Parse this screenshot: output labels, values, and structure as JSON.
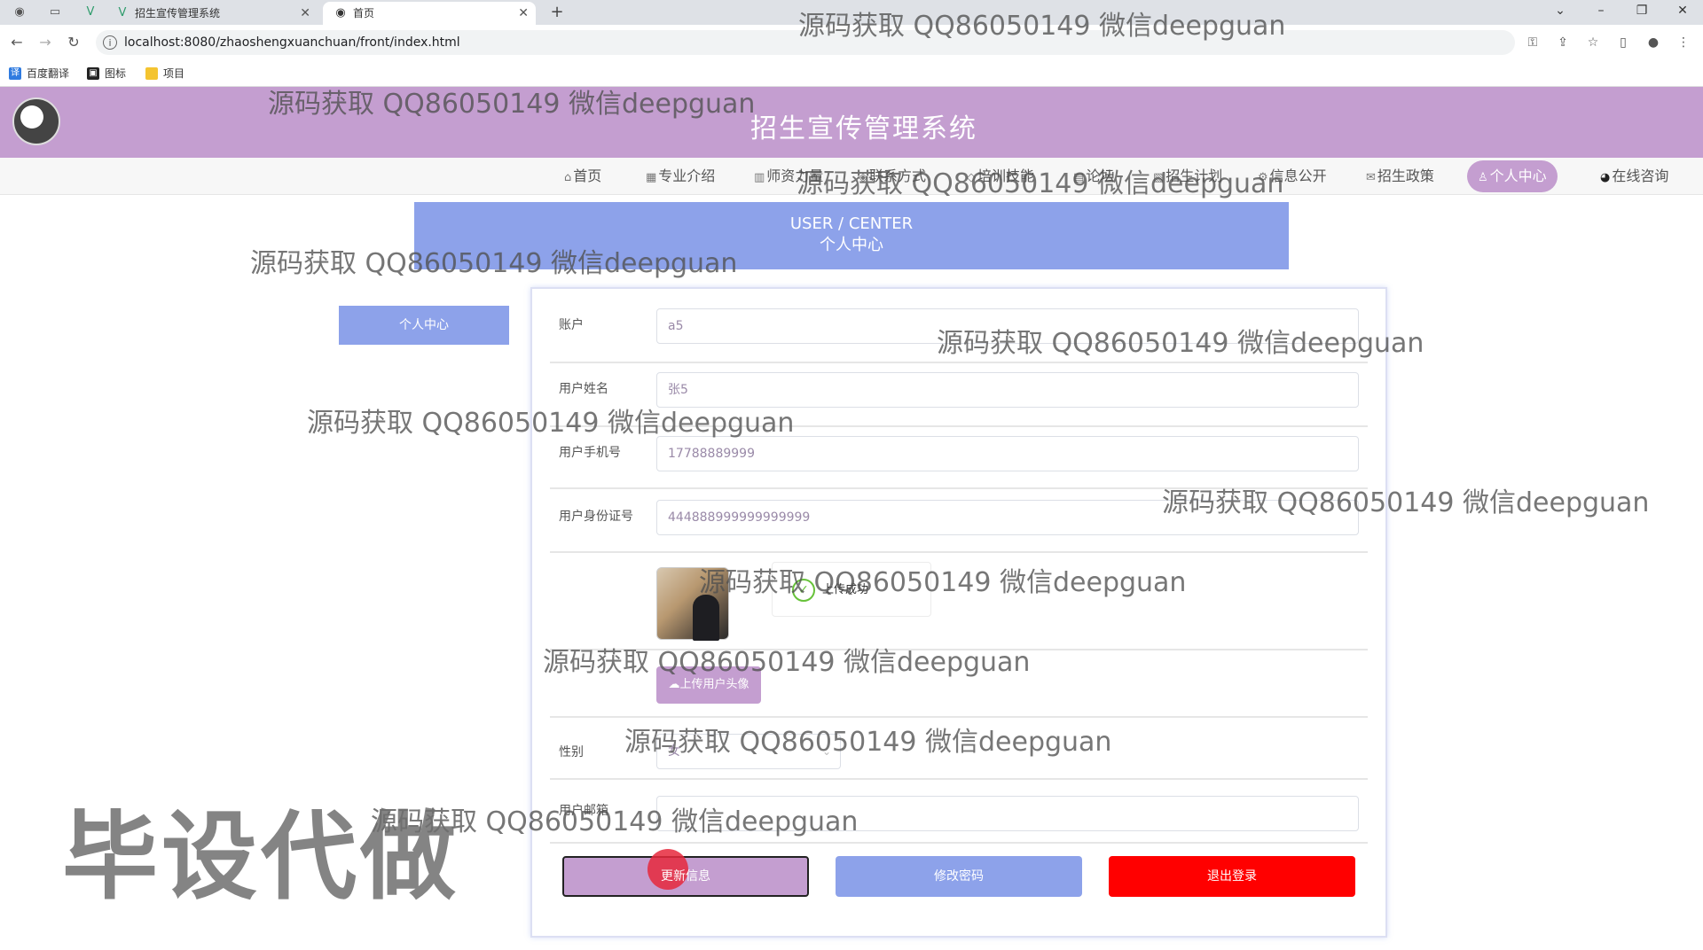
{
  "browser": {
    "tabs": [
      {
        "label": "招生宣传管理系统",
        "active": false
      },
      {
        "label": "首页",
        "active": true
      }
    ],
    "url": "localhost:8080/zhaoshengxuanchuan/front/index.html",
    "bookmarks": [
      "百度翻译",
      "图标",
      "项目"
    ]
  },
  "site": {
    "title": "招生宣传管理系统",
    "nav": [
      {
        "label": "首页",
        "icon": "home-icon",
        "active": false
      },
      {
        "label": "专业介绍",
        "icon": "grid-icon",
        "active": false
      },
      {
        "label": "师资力量",
        "icon": "building-icon",
        "active": false
      },
      {
        "label": "联系方式",
        "icon": "contact-icon",
        "active": false
      },
      {
        "label": "培训技能",
        "icon": "skill-icon",
        "active": false
      },
      {
        "label": "论坛",
        "icon": "forum-icon",
        "active": false
      },
      {
        "label": "招生计划",
        "icon": "plan-icon",
        "active": false
      },
      {
        "label": "信息公开",
        "icon": "info-icon",
        "active": false
      },
      {
        "label": "招生政策",
        "icon": "mail-icon",
        "active": false
      },
      {
        "label": "个人中心",
        "icon": "user-icon",
        "active": true
      },
      {
        "label": "在线咨询",
        "icon": "chat-icon",
        "active": false
      }
    ],
    "banner": {
      "en": "USER / CENTER",
      "cn": "个人中心"
    },
    "sidebar_button": "个人中心"
  },
  "form": {
    "account": {
      "label": "账户",
      "value": "a5"
    },
    "name": {
      "label": "用户姓名",
      "value": "张5"
    },
    "phone": {
      "label": "用户手机号",
      "value": "17788889999"
    },
    "idcard": {
      "label": "用户身份证号",
      "value": "444888999999999999"
    },
    "upload_success": "上传成功",
    "upload_button": "上传用户头像",
    "gender": {
      "label": "性别",
      "value": "女"
    },
    "email": {
      "label": "用户邮箱",
      "value": ""
    },
    "buttons": {
      "update": "更新信息",
      "change_password": "修改密码",
      "logout": "退出登录"
    }
  },
  "watermarks": {
    "text": "源码获取 QQ86050149 微信deepguan",
    "big": "毕设代做"
  },
  "colors": {
    "theme_purple": "#c49ed0",
    "theme_blue": "#8da2ea",
    "danger": "#ff0000"
  }
}
